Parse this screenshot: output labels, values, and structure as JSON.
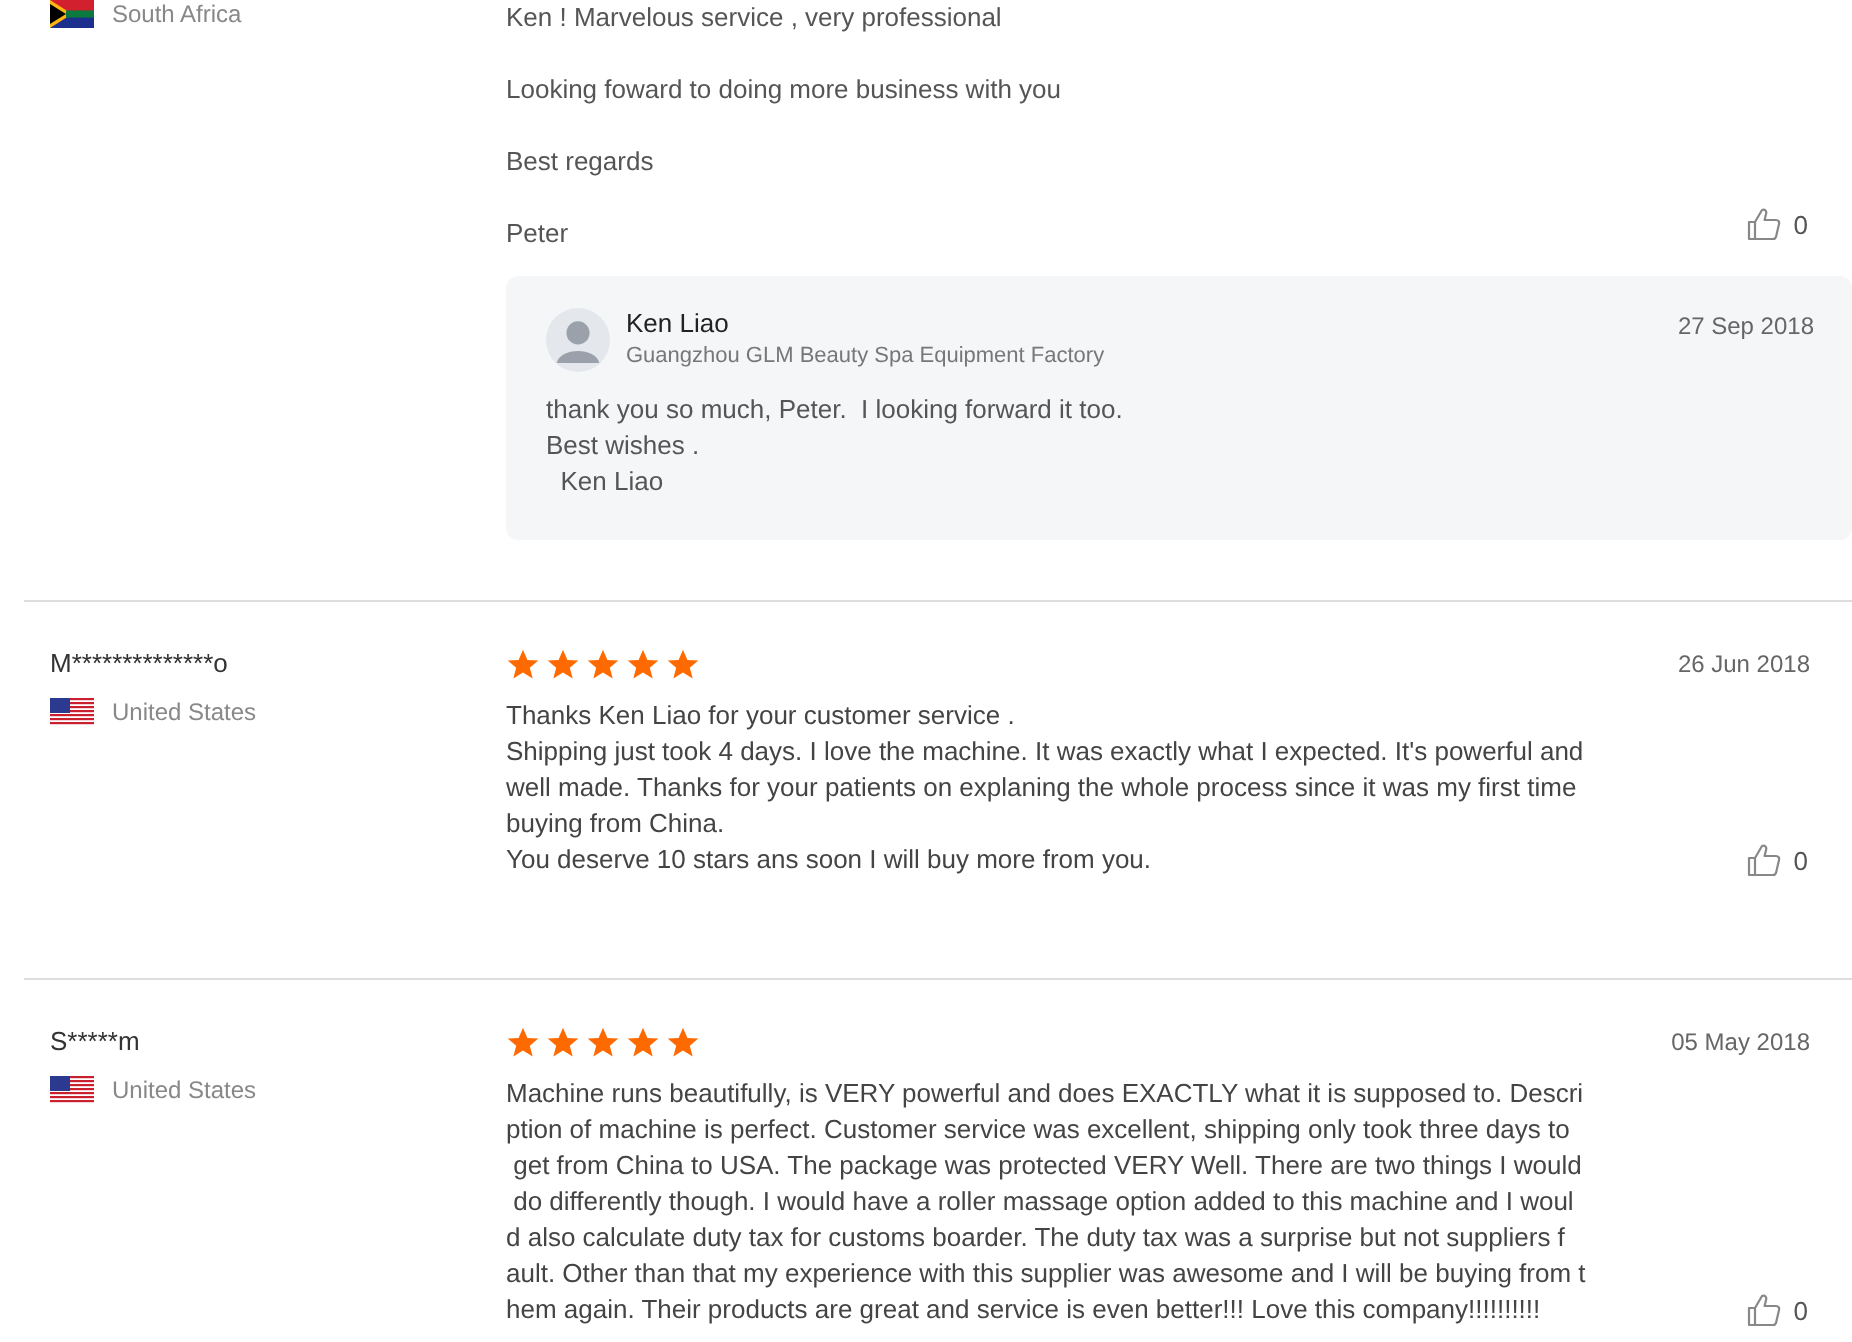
{
  "reviews": [
    {
      "country": "South Africa",
      "kind": "za",
      "paragraphs": [
        "Ken ! Marvelous service , very professional",
        "Looking foward to doing more business with you",
        "Best regards",
        "Peter"
      ],
      "likes": "0",
      "reply": {
        "name": "Ken Liao",
        "company": "Guangzhou GLM Beauty Spa Equipment Factory",
        "date": "27 Sep 2018",
        "lines": [
          "thank you so much, Peter.  I looking forward it too.",
          "Best wishes .",
          "  Ken Liao"
        ]
      }
    },
    {
      "name": "M**************o",
      "country": "United States",
      "kind": "us",
      "stars": 5,
      "date": "26 Jun 2018",
      "lines": [
        "Thanks Ken Liao for your customer service .",
        "Shipping just took 4 days. I love the machine. It was exactly what I expected. It's powerful and",
        "well made. Thanks for your patients on explaning the whole process since it was my first time",
        "buying from China.",
        "You deserve 10 stars ans soon I will buy more from you."
      ],
      "likes": "0"
    },
    {
      "name": "S*****m",
      "country": "United States",
      "kind": "us",
      "stars": 5,
      "date": "05 May 2018",
      "lines": [
        "Machine runs beautifully, is VERY powerful and does EXACTLY what it is supposed to. Descri",
        "ption of machine is perfect. Customer service was excellent, shipping only took three days to",
        " get from China to USA. The package was protected VERY Well. There are two things I would",
        " do differently though. I would have a roller massage option added to this machine and I woul",
        "d also calculate duty tax for customs boarder. The duty tax was a surprise but not suppliers f",
        "ault. Other than that my experience with this supplier was awesome and I will be buying from t",
        "hem again. Their products are great and service is even better!!! Love this company!!!!!!!!!!"
      ],
      "likes": "0"
    }
  ]
}
